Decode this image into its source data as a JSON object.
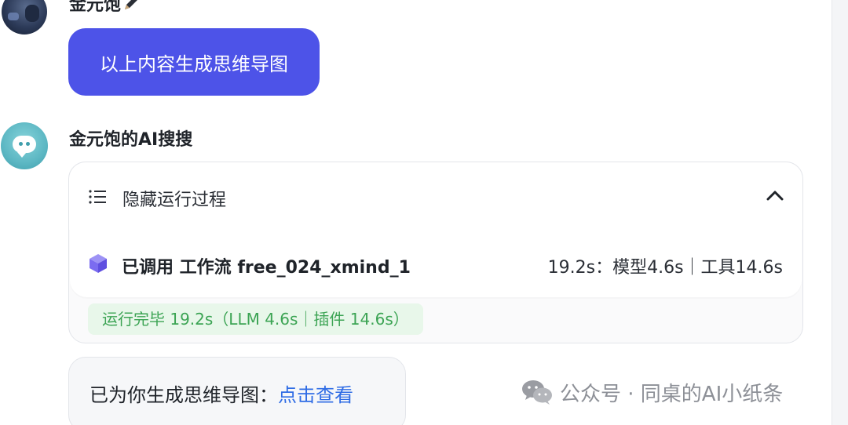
{
  "user": {
    "name": "金元饱",
    "message": "以上内容生成思维导图"
  },
  "bot": {
    "name": "金元饱的AI搜搜"
  },
  "process_card": {
    "toggle_label": "隐藏运行过程",
    "tool_call": {
      "title": "已调用 工作流 free_024_xmind_1",
      "timing": "19.2s：模型4.6s｜工具14.6s"
    },
    "status": "运行完毕 19.2s（LLM 4.6s｜插件 14.6s）"
  },
  "result": {
    "text": "已为你生成思维导图：",
    "link_label": "点击查看"
  },
  "watermark": {
    "text": "公众号 · 同桌的AI小纸条"
  },
  "colors": {
    "accent": "#4d53e8",
    "link": "#2f6ce5",
    "status_green": "#3ca454",
    "status_bg": "#e8f7ea",
    "cube_purple": "#7b6cf0"
  }
}
